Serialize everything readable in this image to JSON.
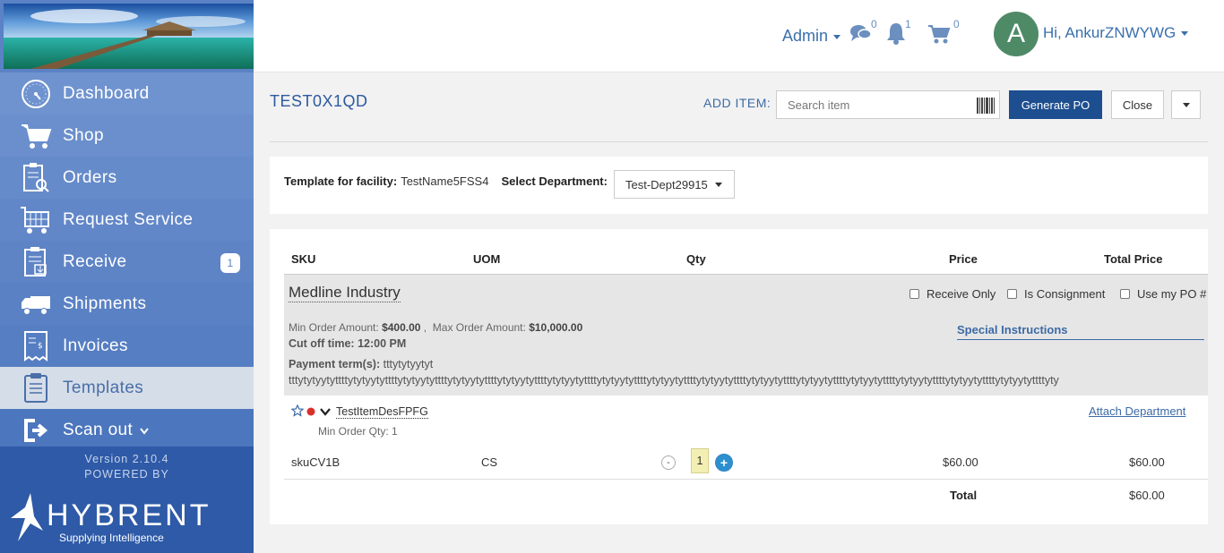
{
  "colors": {
    "sidebar": "#5a82c4",
    "sidebar_footer": "#2e5aa7",
    "accent": "#1d4e8f",
    "link": "#3c6aa6",
    "avatar": "#4f8a67",
    "active_nav_bg": "#d5dde8"
  },
  "header": {
    "admin_label": "Admin",
    "chat_count": "0",
    "notification_count": "1",
    "cart_count": "0",
    "avatar_letter": "A",
    "greeting": "Hi, AnkurZNWYWG"
  },
  "sidebar": {
    "items": [
      {
        "label": "Dashboard",
        "icon": "dashboard-clock-icon"
      },
      {
        "label": "Shop",
        "icon": "cart-icon"
      },
      {
        "label": "Orders",
        "icon": "orders-search-icon"
      },
      {
        "label": "Request Service",
        "icon": "request-service-cart-icon"
      },
      {
        "label": "Receive",
        "icon": "receive-clipboard-icon",
        "badge": "1"
      },
      {
        "label": "Shipments",
        "icon": "truck-icon"
      },
      {
        "label": "Invoices",
        "icon": "invoice-icon"
      },
      {
        "label": "Templates",
        "icon": "clipboard-icon",
        "active": true
      },
      {
        "label": "Scan out",
        "icon": "sign-out-icon"
      }
    ],
    "version": "Version 2.10.4",
    "powered_by": "POWERED BY",
    "brand": "HYBRENT",
    "brand_tagline": "Supplying Intelligence"
  },
  "toolbar": {
    "page_title": "TEST0X1QD",
    "add_item_label": "ADD ITEM:",
    "search_placeholder": "Search item",
    "generate_po_label": "Generate PO",
    "close_label": "Close"
  },
  "facility": {
    "template_label": "Template for facility:",
    "template_value": "TestName5FSS4",
    "department_label": "Select Department:",
    "department_value": "Test-Dept29915"
  },
  "table": {
    "headers": [
      "SKU",
      "UOM",
      "Qty",
      "Price",
      "Total Price"
    ],
    "vendor": {
      "name": "Medline Industry",
      "checkboxes": [
        "Receive Only",
        "Is Consignment",
        "Use my PO #"
      ],
      "min_order_label": "Min Order Amount:",
      "min_order_value": "$400.00",
      "max_order_label": "Max Order Amount:",
      "max_order_value": "$10,000.00",
      "cutoff": "Cut off time: 12:00 PM",
      "special_instructions": "Special Instructions",
      "payment_label": "Payment term(s):",
      "payment_value_inline": "tttytytyytyt",
      "payment_value_line": "tttytytyytyttttytytyytyttttytytyytyttttytytyytyttttytytyytyttttytytyytyttttytytyytyttttytytyytyttttytytyytyttttytytyytyttttytytyytyttttytytyytyttttytytyytyttttytytyytyttttytytyytyttttyty"
    },
    "item": {
      "description": "TestItemDesFPFG",
      "attach_department": "Attach Department",
      "min_qty": "Min Order Qty: 1",
      "sku": "skuCV1B",
      "uom": "CS",
      "minus": "-",
      "qty": "1",
      "plus": "+",
      "price": "$60.00",
      "total_price": "$60.00"
    },
    "total_label": "Total",
    "total_value": "$60.00"
  }
}
